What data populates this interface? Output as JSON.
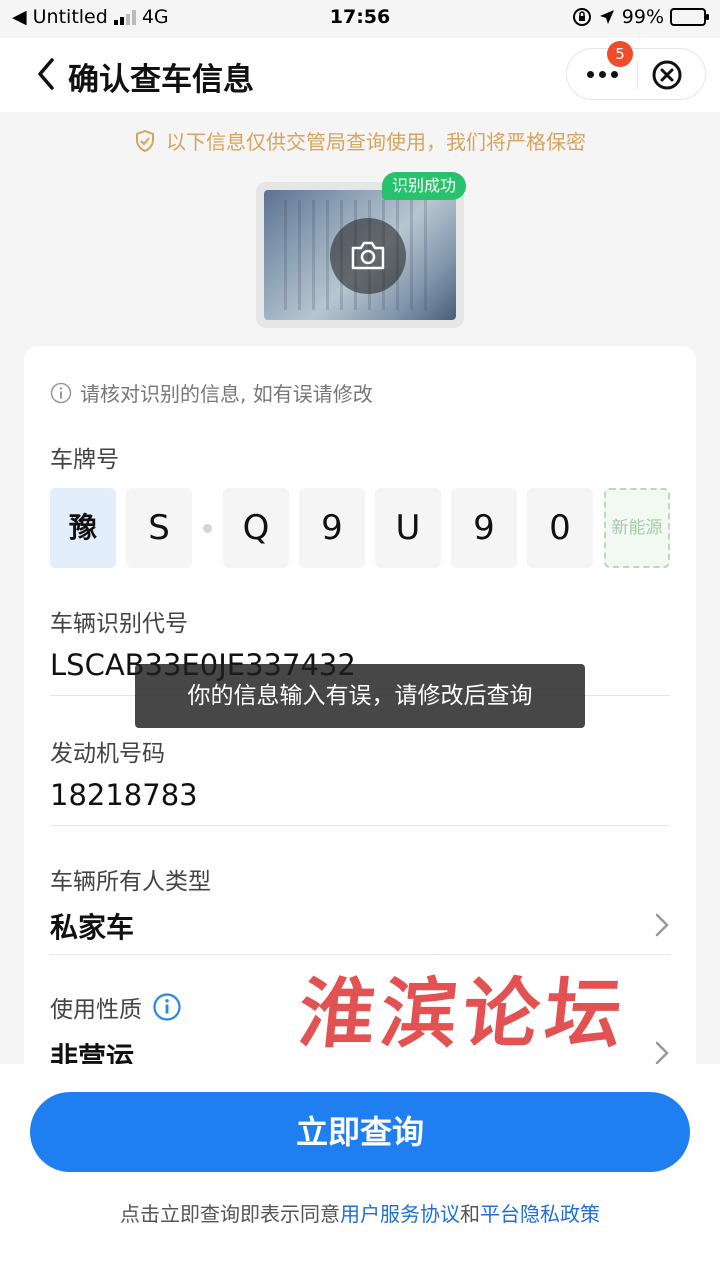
{
  "status_bar": {
    "back_app": "◀ Untitled",
    "network": "4G",
    "time": "17:56",
    "battery": "99%"
  },
  "nav": {
    "title": "确认查车信息",
    "badge_count": "5"
  },
  "notice": "以下信息仅供交管局查询使用，我们将严格保密",
  "photo": {
    "status_badge": "识别成功"
  },
  "form": {
    "hint": "请核对识别的信息, 如有误请修改",
    "plate_label": "车牌号",
    "plate": [
      "豫",
      "S",
      "Q",
      "9",
      "U",
      "9",
      "0"
    ],
    "new_energy_label": "新能源",
    "vin_label": "车辆识别代号",
    "vin_value": "LSCAB33E0JE337432",
    "engine_label": "发动机号码",
    "engine_value": "18218783",
    "owner_type_label": "车辆所有人类型",
    "owner_type_value": "私家车",
    "usage_label": "使用性质",
    "usage_value": "非营运"
  },
  "toast": "你的信息输入有误，请修改后查询",
  "watermark": "淮滨论坛",
  "footer": {
    "cta": "立即查询",
    "agree_prefix": "点击立即查询即表示同意",
    "agree_link1": "用户服务协议",
    "agree_and": "和",
    "agree_link2": "平台隐私政策"
  },
  "colors": {
    "primary": "#1f7ff0",
    "success": "#27c26b",
    "notice": "#d7a45c",
    "badge": "#f04b2a",
    "watermark": "#e03b3b"
  }
}
